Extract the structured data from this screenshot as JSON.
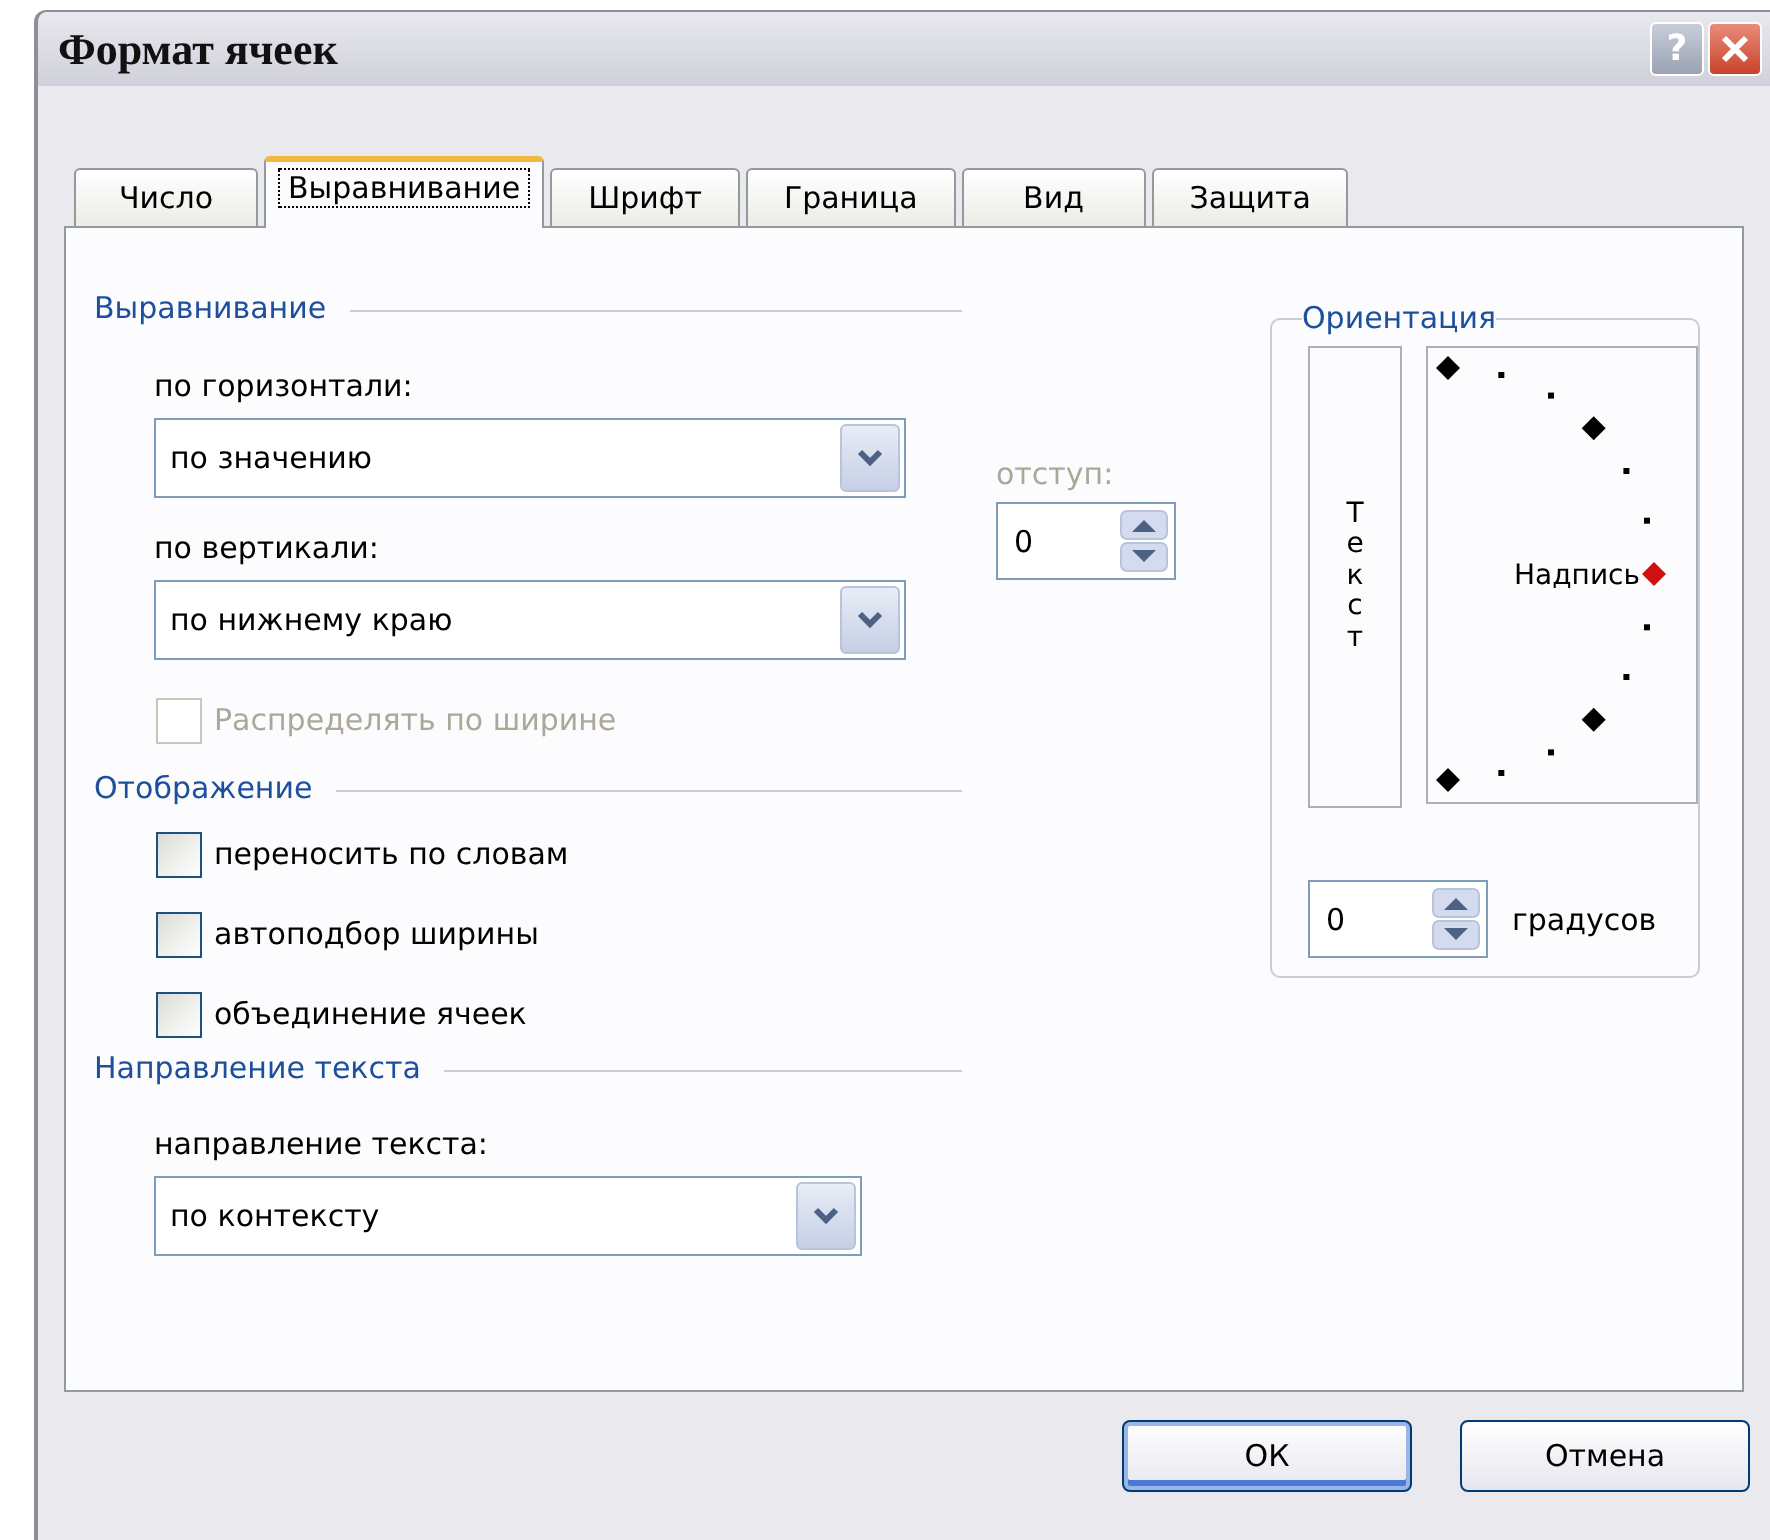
{
  "window": {
    "title": "Формат ячеек",
    "help_button": "?"
  },
  "tabs": [
    {
      "label": "Число",
      "selected": false
    },
    {
      "label": "Выравнивание",
      "selected": true
    },
    {
      "label": "Шрифт",
      "selected": false
    },
    {
      "label": "Граница",
      "selected": false
    },
    {
      "label": "Вид",
      "selected": false
    },
    {
      "label": "Защита",
      "selected": false
    }
  ],
  "alignment": {
    "heading": "Выравнивание",
    "horizontal": {
      "label": "по горизонтали:",
      "value": "по значению"
    },
    "vertical": {
      "label": "по вертикали:",
      "value": "по нижнему краю"
    },
    "indent": {
      "label": "отступ:",
      "value": "0",
      "disabled": true
    },
    "justify_distributed": {
      "label": "Распределять по ширине",
      "checked": false,
      "disabled": true
    }
  },
  "orientation": {
    "heading": "Ориентация",
    "vertical_text": "Текст",
    "dial_label": "Надпись",
    "degrees": {
      "value": "0",
      "unit": "градусов"
    }
  },
  "display": {
    "heading": "Отображение",
    "options": [
      {
        "label": "переносить по словам",
        "checked": false
      },
      {
        "label": "автоподбор ширины",
        "checked": false
      },
      {
        "label": "объединение ячеек",
        "checked": false
      }
    ]
  },
  "text_direction": {
    "heading": "Направление текста",
    "label": "направление текста:",
    "value": "по контексту"
  },
  "buttons": [
    {
      "label": "ОК",
      "default": true
    },
    {
      "label": "Отмена",
      "default": false
    }
  ]
}
